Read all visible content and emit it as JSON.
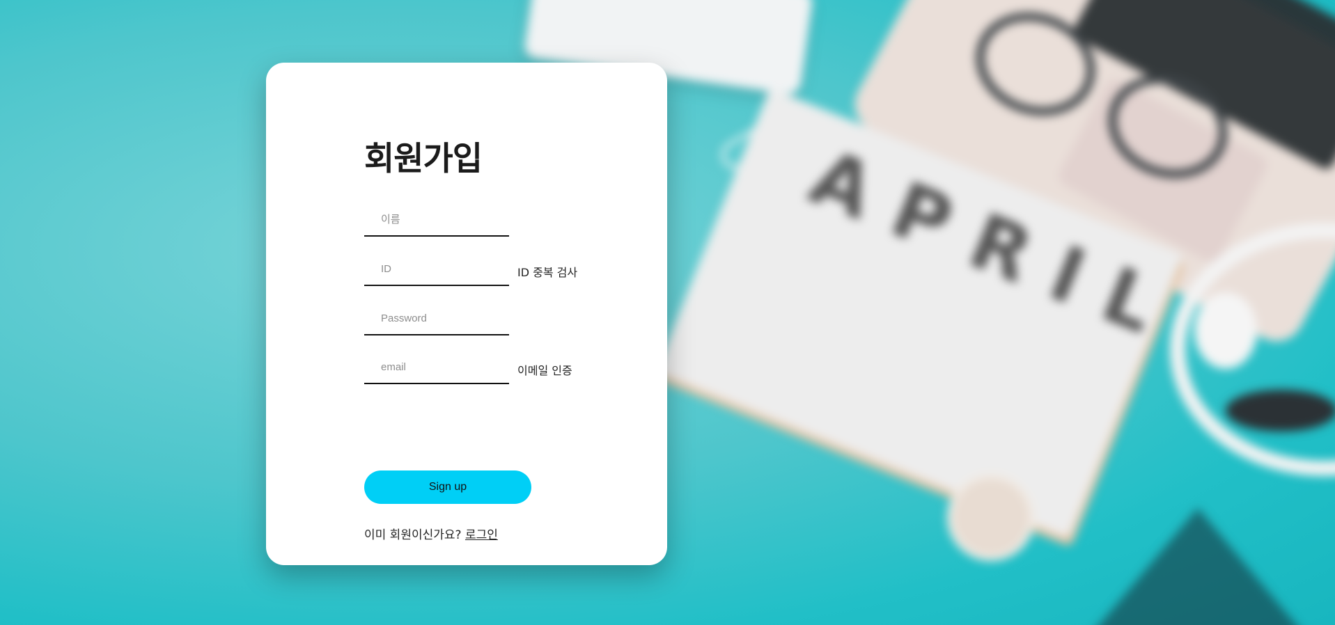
{
  "background": {
    "accent_color": "#21bfc7",
    "calendar_text": "APRIL"
  },
  "signup_form": {
    "title": "회원가입",
    "name_placeholder": "이름",
    "id_placeholder": "ID",
    "id_check_label": "ID 중복 검사",
    "password_placeholder": "Password",
    "email_placeholder": "email",
    "email_verify_label": "이메일 인증",
    "submit_label": "Sign up",
    "submit_color": "#00cff6",
    "footer_text": "이미 회원이신가요?",
    "login_link": "로그인"
  }
}
